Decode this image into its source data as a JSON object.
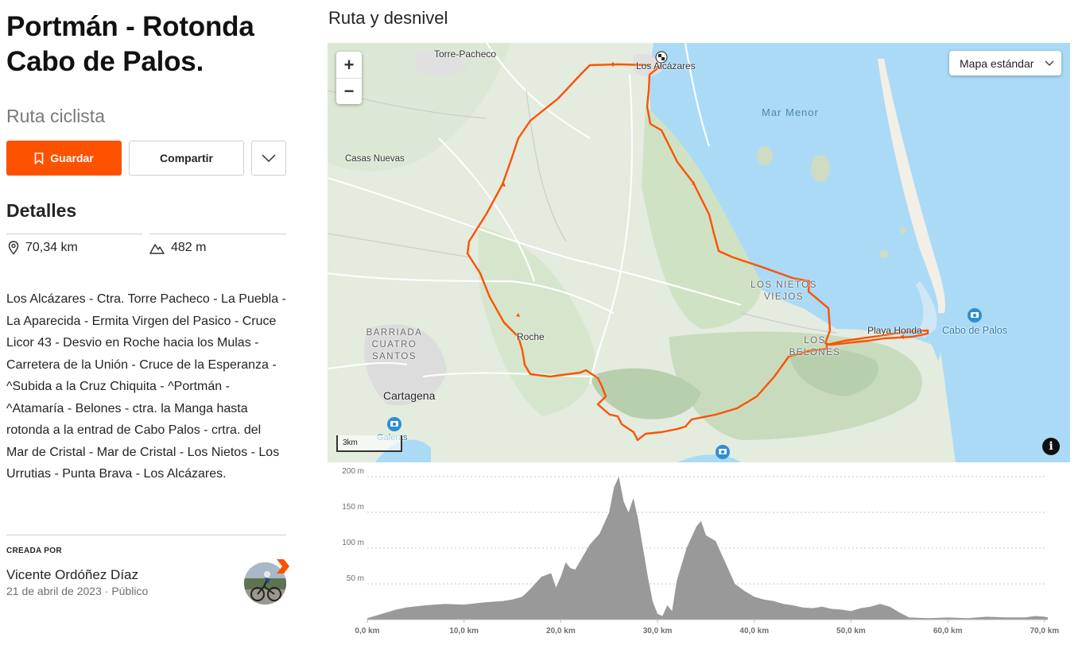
{
  "route": {
    "title_line1": "Portmán - Rotonda",
    "title_line2": "Cabo de Palos.",
    "type": "Ruta ciclista"
  },
  "actions": {
    "save_label": "Guardar",
    "share_label": "Compartir",
    "more_icon": "chevron-down-icon"
  },
  "details": {
    "heading": "Detalles",
    "distance": "70,34 km",
    "elevation": "482 m",
    "description": "Los Alcázares - Ctra. Torre Pacheco - La Puebla - La Aparecida - Ermita Virgen del Pasico - Cruce Licor 43 - Desvio en Roche hacia los Mulas - Carretera de la Unión - Cruce de la Esperanza - ^Subida a la Cruz Chiquita - ^Portmán - ^Atamaría - Belones - ctra. la Manga hasta rotonda a la entrad de Cabo Palos - crtra. del Mar de Cristal - Mar de Cristal - Los Nietos - Los Urrutias - Punta Brava - Los Alcázares."
  },
  "creator": {
    "label": "CREADA POR",
    "name": "Vicente Ordóñez Díaz",
    "date": "21 de abril de 2023",
    "visibility": "Público"
  },
  "map": {
    "section_title": "Ruta y desnivel",
    "map_type": "Mapa estándar",
    "zoom_in": "+",
    "zoom_out": "−",
    "scale": "3km",
    "info": "i",
    "labels": {
      "torre_pacheco": "Torre-Pacheco",
      "los_alcazares": "Los Alcázares",
      "mar_menor": "Mar Menor",
      "casas_nuevas": "Casas Nuevas",
      "los_nietos_viejos": "LOS NIETOS VIEJOS",
      "barriada": "BARRIADA CUATRO SANTOS",
      "roche": "Roche",
      "playa_honda": "Playa Honda",
      "cabo_de_palos": "Cabo de Palos",
      "los_belones": "LOS BELONES",
      "cartagena": "Cartagena",
      "galeras": "Galeras"
    },
    "colors": {
      "route": "#fc5200",
      "water": "#aadaf6",
      "land": "#dfe8d8"
    }
  },
  "chart_data": {
    "type": "area",
    "title": "",
    "xlabel": "",
    "ylabel": "",
    "xlim": [
      0,
      70.34
    ],
    "ylim": [
      0,
      200
    ],
    "grid": true,
    "x_ticks": [
      "0,0 km",
      "10,0 km",
      "20,0 km",
      "30,0 km",
      "40,0 km",
      "50,0 km",
      "60,0 km",
      "70,0 km"
    ],
    "x_tick_values": [
      0,
      10,
      20,
      30,
      40,
      50,
      60,
      70
    ],
    "y_ticks": [
      "50 m",
      "100 m",
      "150 m",
      "200 m"
    ],
    "y_tick_values": [
      50,
      100,
      150,
      200
    ],
    "series": [
      {
        "color": "#999999",
        "x": [
          0,
          1,
          2,
          3,
          4,
          6,
          8,
          10,
          12,
          14,
          15,
          16,
          16.5,
          17,
          18,
          19,
          19.5,
          20,
          20.5,
          21,
          21.5,
          22,
          23,
          24,
          25,
          25.5,
          26,
          26.5,
          27,
          27.5,
          28,
          29,
          29.5,
          30,
          30.5,
          31,
          31.5,
          32,
          33,
          34,
          34.5,
          35,
          36,
          37,
          38,
          39,
          40,
          41,
          42,
          43,
          44,
          45,
          46,
          47,
          48,
          49,
          50,
          51,
          52,
          53,
          54,
          55,
          56,
          58,
          60,
          62,
          64,
          66,
          68,
          69,
          70,
          70.34
        ],
        "y": [
          2,
          6,
          10,
          14,
          17,
          20,
          22,
          21,
          24,
          26,
          28,
          32,
          38,
          45,
          60,
          65,
          45,
          60,
          80,
          72,
          70,
          82,
          105,
          120,
          150,
          185,
          200,
          165,
          150,
          170,
          140,
          60,
          25,
          8,
          5,
          20,
          12,
          55,
          100,
          130,
          138,
          118,
          110,
          80,
          50,
          40,
          32,
          28,
          26,
          22,
          20,
          17,
          16,
          18,
          15,
          14,
          12,
          16,
          18,
          22,
          18,
          10,
          3,
          2,
          3,
          2,
          4,
          3,
          3,
          5,
          4,
          3
        ]
      }
    ]
  }
}
